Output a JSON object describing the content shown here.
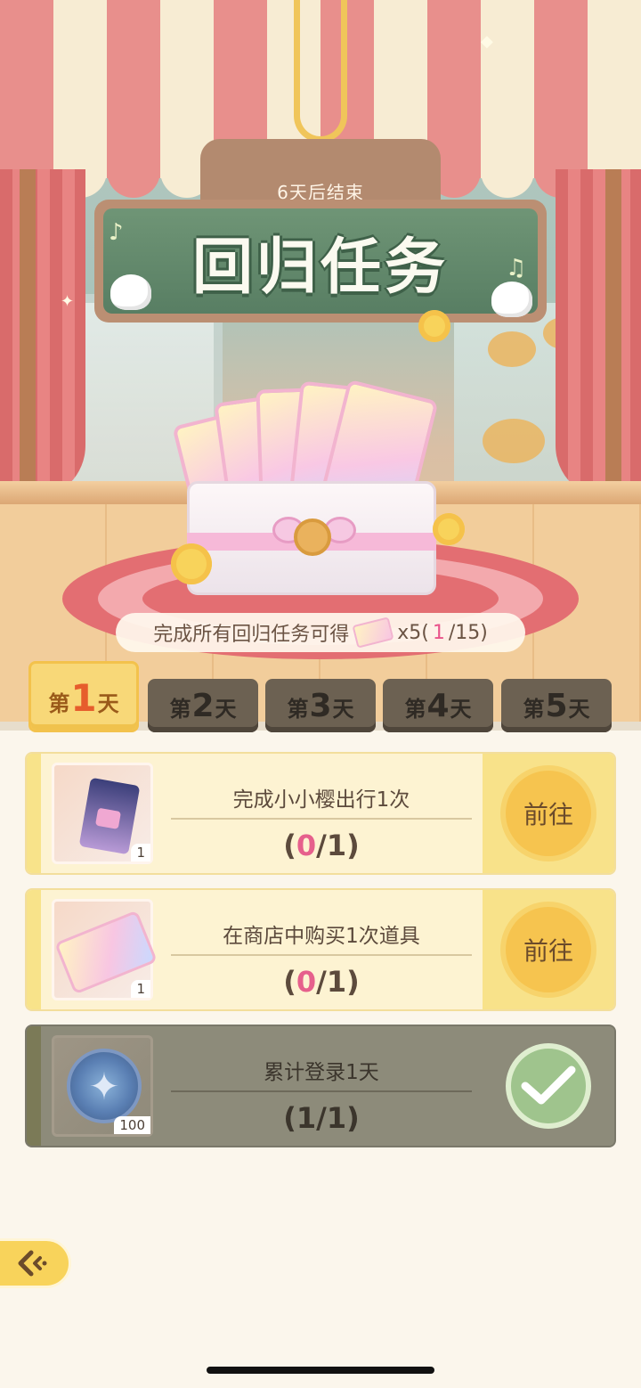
{
  "event": {
    "countdown": "6天后结束",
    "title": "回归任务",
    "reward_text": "完成所有回归任务可得",
    "reward_multiplier": "x5(",
    "reward_done": "1",
    "reward_total": "/15)"
  },
  "tabs": [
    {
      "prefix": "第",
      "num": "1",
      "suffix": "天",
      "active": true
    },
    {
      "prefix": "第",
      "num": "2",
      "suffix": "天",
      "active": false
    },
    {
      "prefix": "第",
      "num": "3",
      "suffix": "天",
      "active": false
    },
    {
      "prefix": "第",
      "num": "4",
      "suffix": "天",
      "active": false
    },
    {
      "prefix": "第",
      "num": "5",
      "suffix": "天",
      "active": false
    }
  ],
  "tasks": [
    {
      "title": "完成小小樱出行1次",
      "current": "0",
      "target": "1",
      "item_count": "1",
      "item_icon": "travel-ticket-icon",
      "action": "前往",
      "status": "pending"
    },
    {
      "title": "在商店中购买1次道具",
      "current": "0",
      "target": "1",
      "item_count": "1",
      "item_icon": "gacha-ticket-icon",
      "action": "前往",
      "status": "pending"
    },
    {
      "title": "累计登录1天",
      "current": "1",
      "target": "1",
      "item_count": "100",
      "item_icon": "star-coin-icon",
      "action": "",
      "status": "completed"
    }
  ],
  "icons": {
    "back": "back-arrow-icon",
    "check": "checkmark-icon"
  },
  "colors": {
    "accent": "#f8d35b",
    "progress_highlight": "#e6608c",
    "done_card": "#8d8b7a"
  }
}
